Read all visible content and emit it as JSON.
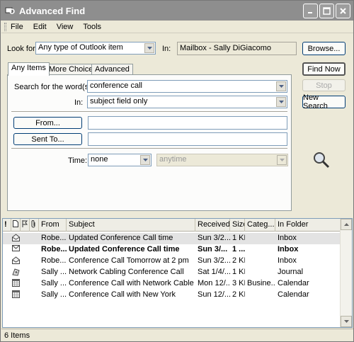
{
  "window": {
    "title": "Advanced Find"
  },
  "menu": [
    "File",
    "Edit",
    "View",
    "Tools"
  ],
  "look_for": {
    "label": "Look for:",
    "value": "Any type of Outlook item",
    "in_label": "In:",
    "in_value": "Mailbox - Sally DiGiacomo",
    "browse": "Browse..."
  },
  "tabs": [
    "Any Items",
    "More Choices",
    "Advanced"
  ],
  "search": {
    "words_label": "Search for the word(s):",
    "words_value": "conference call",
    "in_label": "In:",
    "in_value": "subject field only"
  },
  "from": {
    "button": "From...",
    "value": ""
  },
  "sent_to": {
    "button": "Sent To...",
    "value": ""
  },
  "time": {
    "label": "Time:",
    "value": "none",
    "range": "anytime"
  },
  "actions": {
    "find_now": "Find Now",
    "stop": "Stop",
    "new_search": "New Search"
  },
  "list": {
    "headers": [
      "!",
      "",
      "",
      "",
      "From",
      "Subject",
      "Received",
      "Size",
      "Categ...",
      "In Folder"
    ],
    "rows": [
      {
        "icon": "envelope-open-icon",
        "from": "Robe...",
        "subject": "Updated Conference Call time",
        "received": "Sun 3/2...",
        "size": "1 KB",
        "category": "",
        "folder": "Inbox",
        "bold": false,
        "selected": true
      },
      {
        "icon": "envelope-icon",
        "from": "Robe...",
        "subject": "Updated Conference Call time",
        "received": "Sun 3/...",
        "size": "1 ...",
        "category": "",
        "folder": "Inbox",
        "bold": true,
        "selected": false
      },
      {
        "icon": "envelope-open-icon",
        "from": "Robe...",
        "subject": "Conference Call Tomorrow at 2 pm",
        "received": "Sun 3/2...",
        "size": "2 KB",
        "category": "",
        "folder": "Inbox",
        "bold": false,
        "selected": false
      },
      {
        "icon": "journal-icon",
        "from": "Sally ...",
        "subject": "Network Cabling Conference Call",
        "received": "Sat 1/4/...",
        "size": "1 KB",
        "category": "",
        "folder": "Journal",
        "bold": false,
        "selected": false
      },
      {
        "icon": "calendar-icon",
        "from": "Sally ...",
        "subject": "Conference Call with Network Cable Inst...",
        "received": "Mon 12/...",
        "size": "3 KB",
        "category": "Busine...",
        "folder": "Calendar",
        "bold": false,
        "selected": false
      },
      {
        "icon": "calendar-icon",
        "from": "Sally ...",
        "subject": "Conference Call with New York",
        "received": "Sun 12/...",
        "size": "2 KB",
        "category": "",
        "folder": "Calendar",
        "bold": false,
        "selected": false
      }
    ]
  },
  "status": {
    "count": "6 Items"
  }
}
